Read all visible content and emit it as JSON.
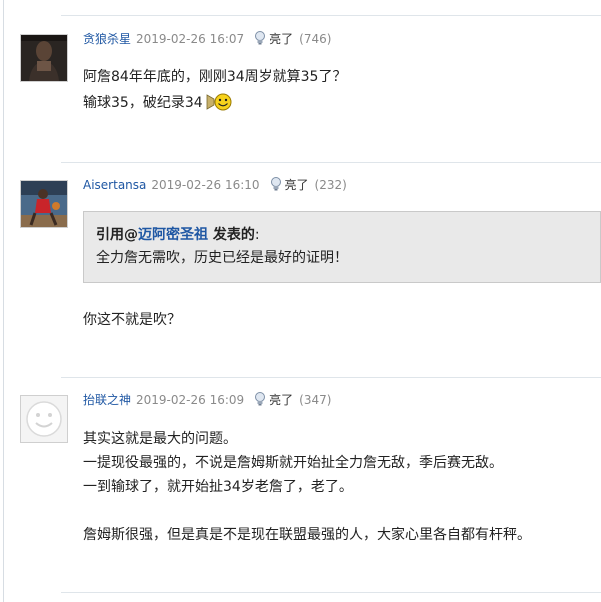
{
  "posts": [
    {
      "user": "贪狼杀星",
      "time": "2019-02-26 16:07",
      "light_label": "亮了",
      "light_count": "(746)",
      "lines": [
        "阿詹84年年底的，刚刚34周岁就算35了？",
        "输球35，破纪录34"
      ]
    },
    {
      "user": "Aisertansa",
      "time": "2019-02-26 16:10",
      "light_label": "亮了",
      "light_count": "(232)",
      "quote": {
        "prefix": "引用@",
        "user": "迈阿密圣祖",
        "suffix": " 发表的",
        "colon": ":",
        "text": "全力詹无需吹，历史已经是最好的证明！"
      },
      "lines": [
        "你这不就是吹？"
      ]
    },
    {
      "user": "抬联之神",
      "time": "2019-02-26 16:09",
      "light_label": "亮了",
      "light_count": "(347)",
      "lines": [
        "其实这就是最大的问题。",
        "一提现役最强的，不说是詹姆斯就开始扯全力詹无敌，季后赛无敌。",
        "一到输球了，就开始扯34岁老詹了，老了。",
        "詹姆斯很强，但是真是不是现在联盟最强的人，大家心里各自都有杆秤。"
      ]
    }
  ],
  "icons": {
    "light": "lightbulb-icon",
    "emoji": "smiley-emoji-icon",
    "default_avatar": "default-avatar-face"
  },
  "colors": {
    "username": "#1f57a3",
    "meta": "#8a8a8a",
    "quote_bg": "#e9e9e9",
    "separator": "#dfe5ea"
  }
}
